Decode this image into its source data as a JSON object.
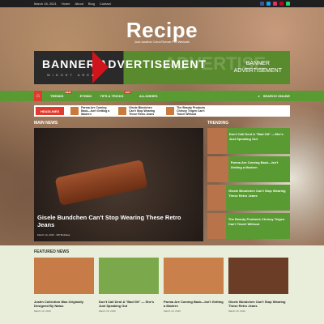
{
  "topbar": {
    "date": "March 18, 2021",
    "links": [
      "Home",
      "About",
      "Blog",
      "Contact"
    ]
  },
  "logo": {
    "title": "Recipe",
    "tagline": "Just another CenoTheme Pro Website"
  },
  "banner": {
    "title": "BANNER ADVERTISEMENT",
    "sub": "WIDGET AREA",
    "right_line1": "BANNER",
    "right_line2": "ADVERTISEMENT",
    "ghost": "ADVERTISE"
  },
  "nav": {
    "home": "⌂",
    "items": [
      "TRENDS",
      "ETHNIC",
      "TIPS & TRICKS",
      "ALLDISHES"
    ],
    "badge_trends": "NEW",
    "badge_tips": "HOT",
    "search_label": "SEARCH ONLINE"
  },
  "ticker": {
    "label": "HEADLINES",
    "items": [
      "Parma Are Coming Back—Isn't Getting a Modern",
      "Gisele Bündchen Can't Stop Wearing These Retro Jeans",
      "The Beauty Products Chrissy Teigen Can't Travel Without"
    ]
  },
  "main": {
    "label": "MAIN NEWS",
    "title": "Gisele Bundchen Can't Stop Wearing These Retro Jeans",
    "meta": "March 10, 2016 · WP Buildass"
  },
  "trending": {
    "label": "TRENDING",
    "items": [
      "Don't Call Dent A \"Bad Git\" —She's Just Speaking Out",
      "Parma Are Coming Back—Isn't Getting a Modern",
      "Gisele Bündchen Can't Stop Wearing These Retro Jeans",
      "The Beauty Products Chrissy Teigen Can't Travel Without"
    ]
  },
  "featured": {
    "label": "FEATURED NEWS",
    "items": [
      {
        "title": "Justin Collection Was Originally Designed By Natus",
        "meta": "March 10, 2016"
      },
      {
        "title": "Don't Call Dent A \"Bad Git\" — She's Just Speaking Out",
        "meta": "March 10, 2016"
      },
      {
        "title": "Parma Are Coming Back—Isn't Getting a Modern",
        "meta": "March 10, 2016"
      },
      {
        "title": "Gisele Bündchen Can't Stop Wearing These Retro Jeans",
        "meta": "March 10, 2016"
      }
    ]
  }
}
